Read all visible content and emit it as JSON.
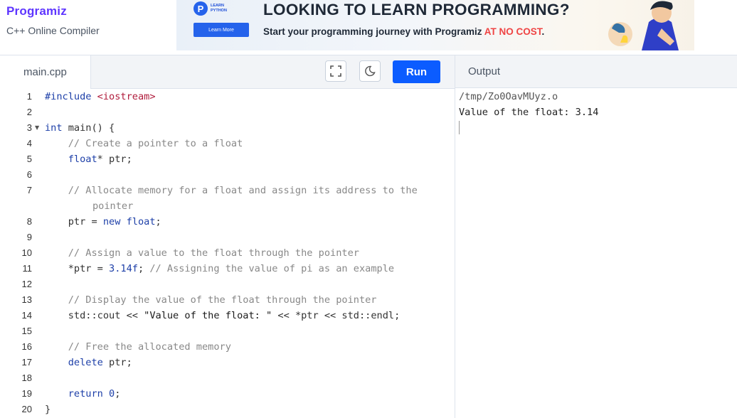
{
  "brand": {
    "logo": "Programiz",
    "subtitle": "C++ Online Compiler"
  },
  "ad": {
    "badge_top": "LEARN",
    "badge_bottom": "PYTHON",
    "button": "Learn More",
    "headline": "LOOKING TO LEARN PROGRAMMING?",
    "subline": "Start your programming journey with Programiz ",
    "highlight": "AT NO COST",
    "end": ".",
    "colors": {
      "accent": "#2563eb",
      "highlight": "#ef4444"
    }
  },
  "editor": {
    "file_tab": "main.cpp",
    "fullscreen_icon": "expand-icon",
    "theme_icon": "moon-icon",
    "run_label": "Run"
  },
  "code_lines": [
    {
      "n": "1",
      "text": "#include <iostream>"
    },
    {
      "n": "2",
      "text": ""
    },
    {
      "n": "3",
      "text": "int main() {"
    },
    {
      "n": "4",
      "text": "    // Create a pointer to a float"
    },
    {
      "n": "5",
      "text": "    float* ptr;"
    },
    {
      "n": "6",
      "text": ""
    },
    {
      "n": "7",
      "text": "    // Allocate memory for a float and assign its address to the pointer"
    },
    {
      "n": "8",
      "text": "    ptr = new float;"
    },
    {
      "n": "9",
      "text": ""
    },
    {
      "n": "10",
      "text": "    // Assign a value to the float through the pointer"
    },
    {
      "n": "11",
      "text": "    *ptr = 3.14f; // Assigning the value of pi as an example"
    },
    {
      "n": "12",
      "text": ""
    },
    {
      "n": "13",
      "text": "    // Display the value of the float through the pointer"
    },
    {
      "n": "14",
      "text": "    std::cout << \"Value of the float: \" << *ptr << std::endl;"
    },
    {
      "n": "15",
      "text": ""
    },
    {
      "n": "16",
      "text": "    // Free the allocated memory"
    },
    {
      "n": "17",
      "text": "    delete ptr;"
    },
    {
      "n": "18",
      "text": ""
    },
    {
      "n": "19",
      "text": "    return 0;"
    },
    {
      "n": "20",
      "text": "}"
    }
  ],
  "output": {
    "label": "Output",
    "lines": [
      "/tmp/Zo0OavMUyz.o",
      "Value of the float: 3.14"
    ]
  }
}
